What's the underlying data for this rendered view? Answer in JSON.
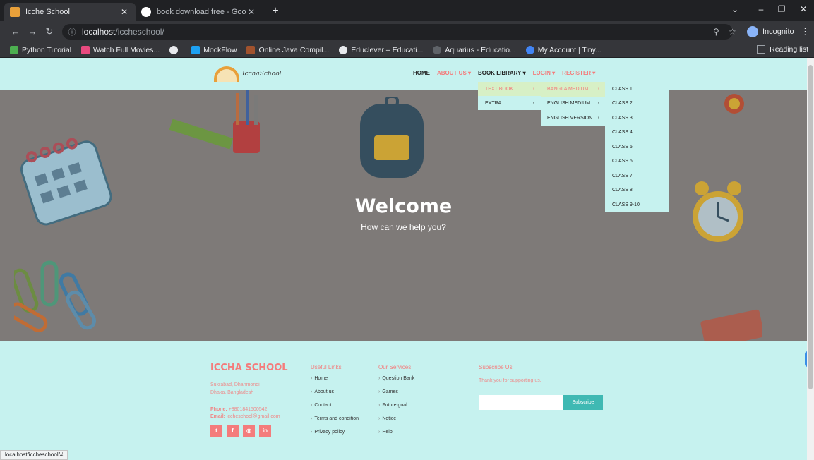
{
  "browser": {
    "tabs": [
      {
        "title": "Icche School",
        "active": true
      },
      {
        "title": "book download free - Google Se",
        "active": false
      }
    ],
    "url_host": "localhost",
    "url_path": "/iccheschool/",
    "profile_label": "Incognito",
    "bookmarks": [
      "Python Tutorial",
      "Watch Full Movies...",
      "MockFlow",
      "Online Java Compil...",
      "Educlever – Educati...",
      "Aquarius - Educatio...",
      "My Account | Tiny..."
    ],
    "reading_list": "Reading list",
    "status_url": "localhost/iccheschool/#"
  },
  "header": {
    "logo_text": "IcchaSchool",
    "nav": [
      "HOME",
      "ABOUT US ▾",
      "BOOK LIBRARY ▾",
      "LOGIN ▾",
      "REGISTER ▾"
    ]
  },
  "dropdowns": {
    "level1": [
      "TEXT BOOK",
      "EXTRA"
    ],
    "level2": [
      "BANGLA MEDIUM",
      "ENGLISH MEDIUM",
      "ENGLISH VERSION"
    ],
    "level3": [
      "CLASS 1",
      "CLASS 2",
      "CLASS 3",
      "CLASS 4",
      "CLASS 5",
      "CLASS 6",
      "CLASS 7",
      "CLASS 8",
      "CLASS 9-10"
    ]
  },
  "hero": {
    "title": "Welcome",
    "subtitle": "How can we help you?"
  },
  "footer": {
    "brand": "ICCHA SCHOOL",
    "address_line1": "Sukrabad, Dhanmondi",
    "address_line2": "Dhaka, Bangladesh",
    "phone_label": "Phone:",
    "phone": "+8801841500542",
    "email_label": "Email:",
    "email": "iccheschool@gmail.com",
    "social": [
      "t",
      "f",
      "◎",
      "in"
    ],
    "useful_links_title": "Useful Links",
    "useful_links": [
      "Home",
      "About us",
      "Contact",
      "Terms and condition",
      "Privacy policy"
    ],
    "services_title": "Our Services",
    "services": [
      "Question Bank",
      "Games",
      "Future goal",
      "Notice",
      "Help"
    ],
    "subscribe_title": "Subscribe Us",
    "subscribe_text": "Thank you for supporting us.",
    "subscribe_button": "Subscribe"
  },
  "colors": {
    "accent": "#f47c7c",
    "background": "#c6f2ef",
    "subscribe_button": "#3fb9b3"
  }
}
